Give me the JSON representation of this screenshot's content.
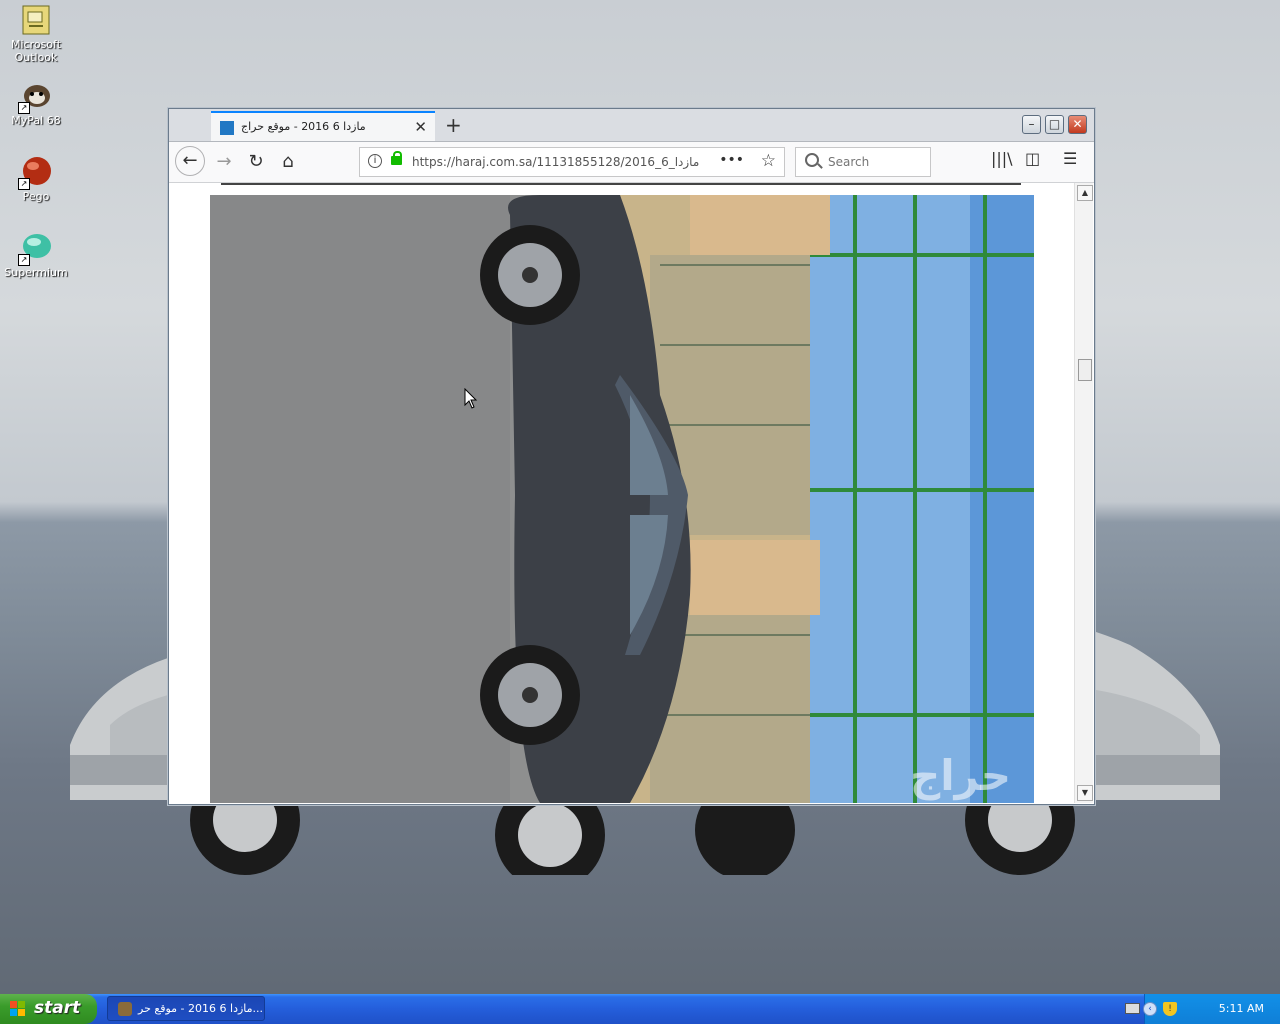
{
  "desktop": {
    "icons": [
      {
        "label": "Microsoft Outlook"
      },
      {
        "label": "MyPal 68"
      },
      {
        "label": "Pego"
      },
      {
        "label": "Supermium"
      }
    ]
  },
  "browser": {
    "tab_title": "مازدا 6 2016 - موقع حراج",
    "url": "https://haraj.com.sa/11131855128/2016_6_مازدا",
    "search_placeholder": "Search",
    "photo_watermark": "حراج"
  },
  "taskbar": {
    "start_label": "start",
    "window_item": "مازدا 6 2016 - موقع حر...",
    "clock": "5:11 AM"
  },
  "colors": {
    "accent_tab": "#0a84ff",
    "secure_lock": "#12bc00",
    "taskbar_blue": "#245edb",
    "start_green": "#3a9c2b"
  }
}
